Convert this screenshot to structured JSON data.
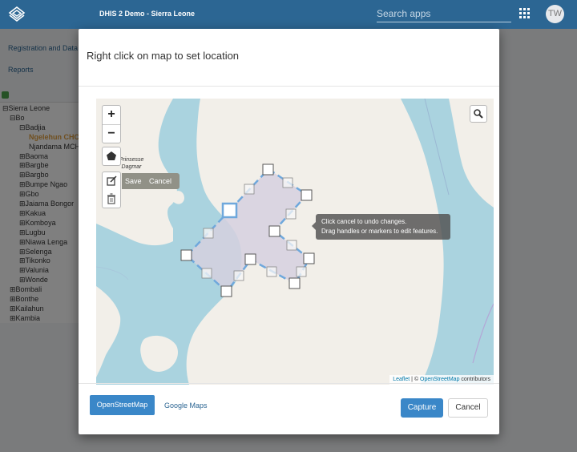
{
  "header": {
    "app_title": "DHIS 2 Demo - Sierra Leone",
    "search_placeholder": "Search apps",
    "avatar_initials": "TW"
  },
  "sidebar": {
    "links": [
      "Registration and Data E",
      "Reports"
    ],
    "tree": [
      {
        "label": "Sierra Leone",
        "toggle": "⊟"
      },
      {
        "label": "Bo",
        "toggle": "⊟"
      },
      {
        "label": "Badjia",
        "toggle": "⊟"
      },
      {
        "label": "Ngelehun CHC",
        "toggle": "",
        "selected": true
      },
      {
        "label": "Njandama MCHP",
        "toggle": ""
      },
      {
        "label": "Baoma",
        "toggle": "⊞"
      },
      {
        "label": "Bargbe",
        "toggle": "⊞"
      },
      {
        "label": "Bargbo",
        "toggle": "⊞"
      },
      {
        "label": "Bumpe Ngao",
        "toggle": "⊞"
      },
      {
        "label": "Gbo",
        "toggle": "⊞"
      },
      {
        "label": "Jaiama Bongor",
        "toggle": "⊞"
      },
      {
        "label": "Kakua",
        "toggle": "⊞"
      },
      {
        "label": "Komboya",
        "toggle": "⊞"
      },
      {
        "label": "Lugbu",
        "toggle": "⊞"
      },
      {
        "label": "Niawa Lenga",
        "toggle": "⊞"
      },
      {
        "label": "Selenga",
        "toggle": "⊞"
      },
      {
        "label": "Tikonko",
        "toggle": "⊞"
      },
      {
        "label": "Valunia",
        "toggle": "⊞"
      },
      {
        "label": "Wonde",
        "toggle": "⊞"
      },
      {
        "label": "Bombali",
        "toggle": "⊞"
      },
      {
        "label": "Bonthe",
        "toggle": "⊞"
      },
      {
        "label": "Kailahun",
        "toggle": "⊞"
      },
      {
        "label": "Kambia",
        "toggle": "⊞"
      }
    ]
  },
  "modal": {
    "title": "Right click on map to set location",
    "map": {
      "zoom_in": "+",
      "zoom_out": "−",
      "edit_save": "Save",
      "edit_cancel": "Cancel",
      "tooltip_line1": "Click cancel to undo changes.",
      "tooltip_line2": "Drag handles or markers to edit features.",
      "place_label": "Prinsesse Dagmar",
      "attribution": {
        "leaflet": "Leaflet",
        "separator": " | © ",
        "osm": "OpenStreetMap",
        "suffix": " contributors"
      }
    },
    "footer": {
      "osm_button": "OpenStreetMap",
      "google_link": "Google Maps",
      "capture_button": "Capture",
      "cancel_button": "Cancel"
    }
  },
  "colors": {
    "header_bg": "#2c6693",
    "water": "#aad3df",
    "land": "#f2efe9",
    "polygon_fill": "#d6d0df",
    "polygon_stroke": "#6fa8dc",
    "primary_button": "#3a87c8"
  },
  "icons": {
    "logo": "dhis2-logo-icon",
    "apps": "apps-grid-icon",
    "draw_polygon": "pentagon-icon",
    "edit": "edit-icon",
    "delete": "trash-icon",
    "search": "search-icon"
  }
}
